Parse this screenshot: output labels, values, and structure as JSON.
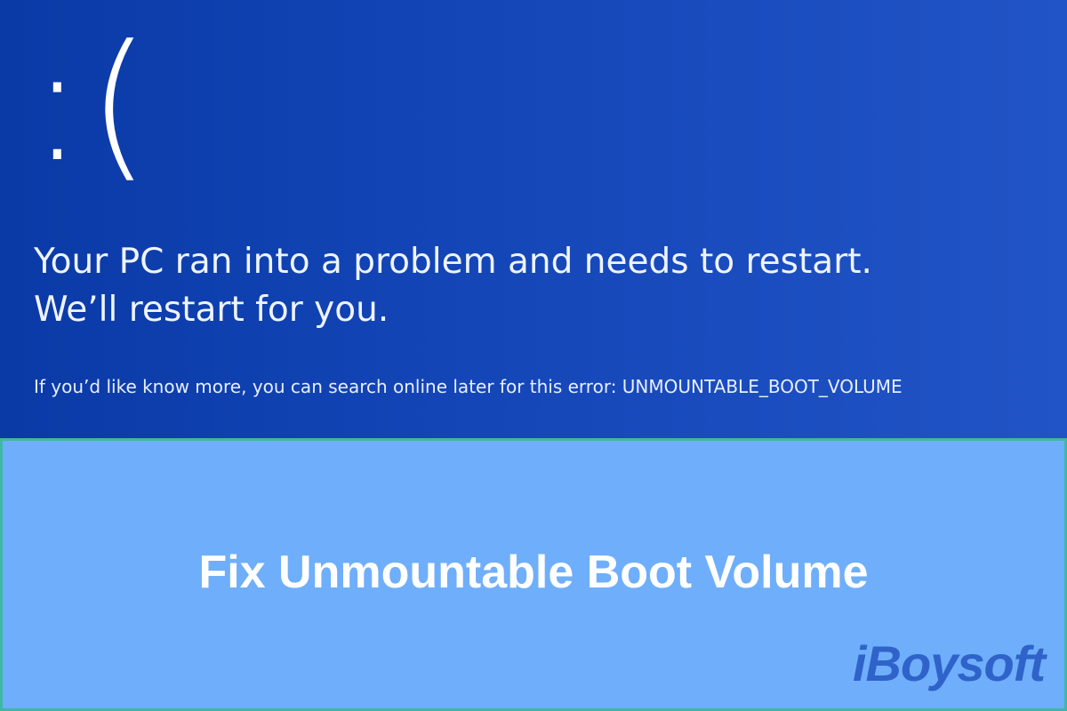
{
  "error_screen": {
    "sad_face": ":(",
    "headline_line1": "Your PC ran into a problem and needs to restart.",
    "headline_line2": "We’ll restart for you.",
    "error_text": "If you’d like know more, you can search online later for this error: UNMOUNTABLE_BOOT_VOLUME"
  },
  "banner": {
    "title": "Fix Unmountable Boot Volume",
    "logo": "iBoysoft"
  },
  "colors": {
    "bsod_blue": "#1446b8",
    "banner_blue": "#6faefb",
    "banner_border": "#3fb7a6",
    "logo_blue": "#2f63c9",
    "text_white": "#ffffff"
  }
}
